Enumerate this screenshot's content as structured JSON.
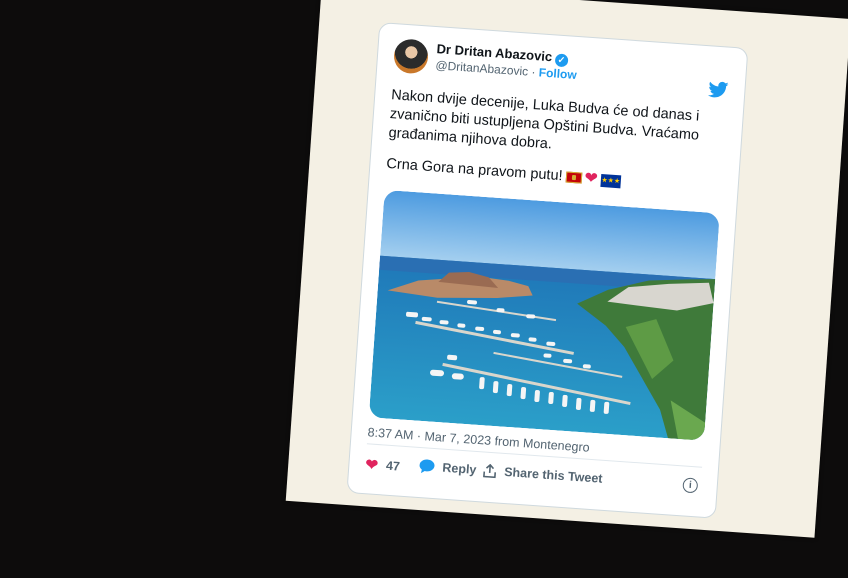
{
  "tweet": {
    "author_name": "Dr Dritan Abazovic",
    "verified_badge": "✓",
    "handle": "@DritanAbazovic",
    "separator": "·",
    "follow_label": "Follow",
    "paragraph_1": "Nakon dvije decenije, Luka Budva će od danas i zvanično biti ustupljena Opštini Budva. Vraćamo građanima njihova dobra.",
    "paragraph_2": "Crna Gora na pravom putu!",
    "emoji": [
      "montenegro-flag",
      "red-heart",
      "eu-flag"
    ],
    "heart_glyph": "❤",
    "eu_stars": "★★★",
    "image": "aerial-marina-budva",
    "time": "8:37 AM",
    "date": "Mar 7, 2023",
    "source": "from Montenegro",
    "likes_count": "47",
    "reply_label": "Reply",
    "share_label": "Share this Tweet",
    "info_glyph": "i",
    "icons": {
      "like": "heart-icon",
      "reply": "speech-bubble-icon",
      "share": "upload-icon",
      "brand": "twitter-bird-icon"
    },
    "colors": {
      "accent": "#1d9bf0",
      "like": "#e0245e",
      "background": "#0d0c0c",
      "paper": "#f4f0e4"
    }
  }
}
